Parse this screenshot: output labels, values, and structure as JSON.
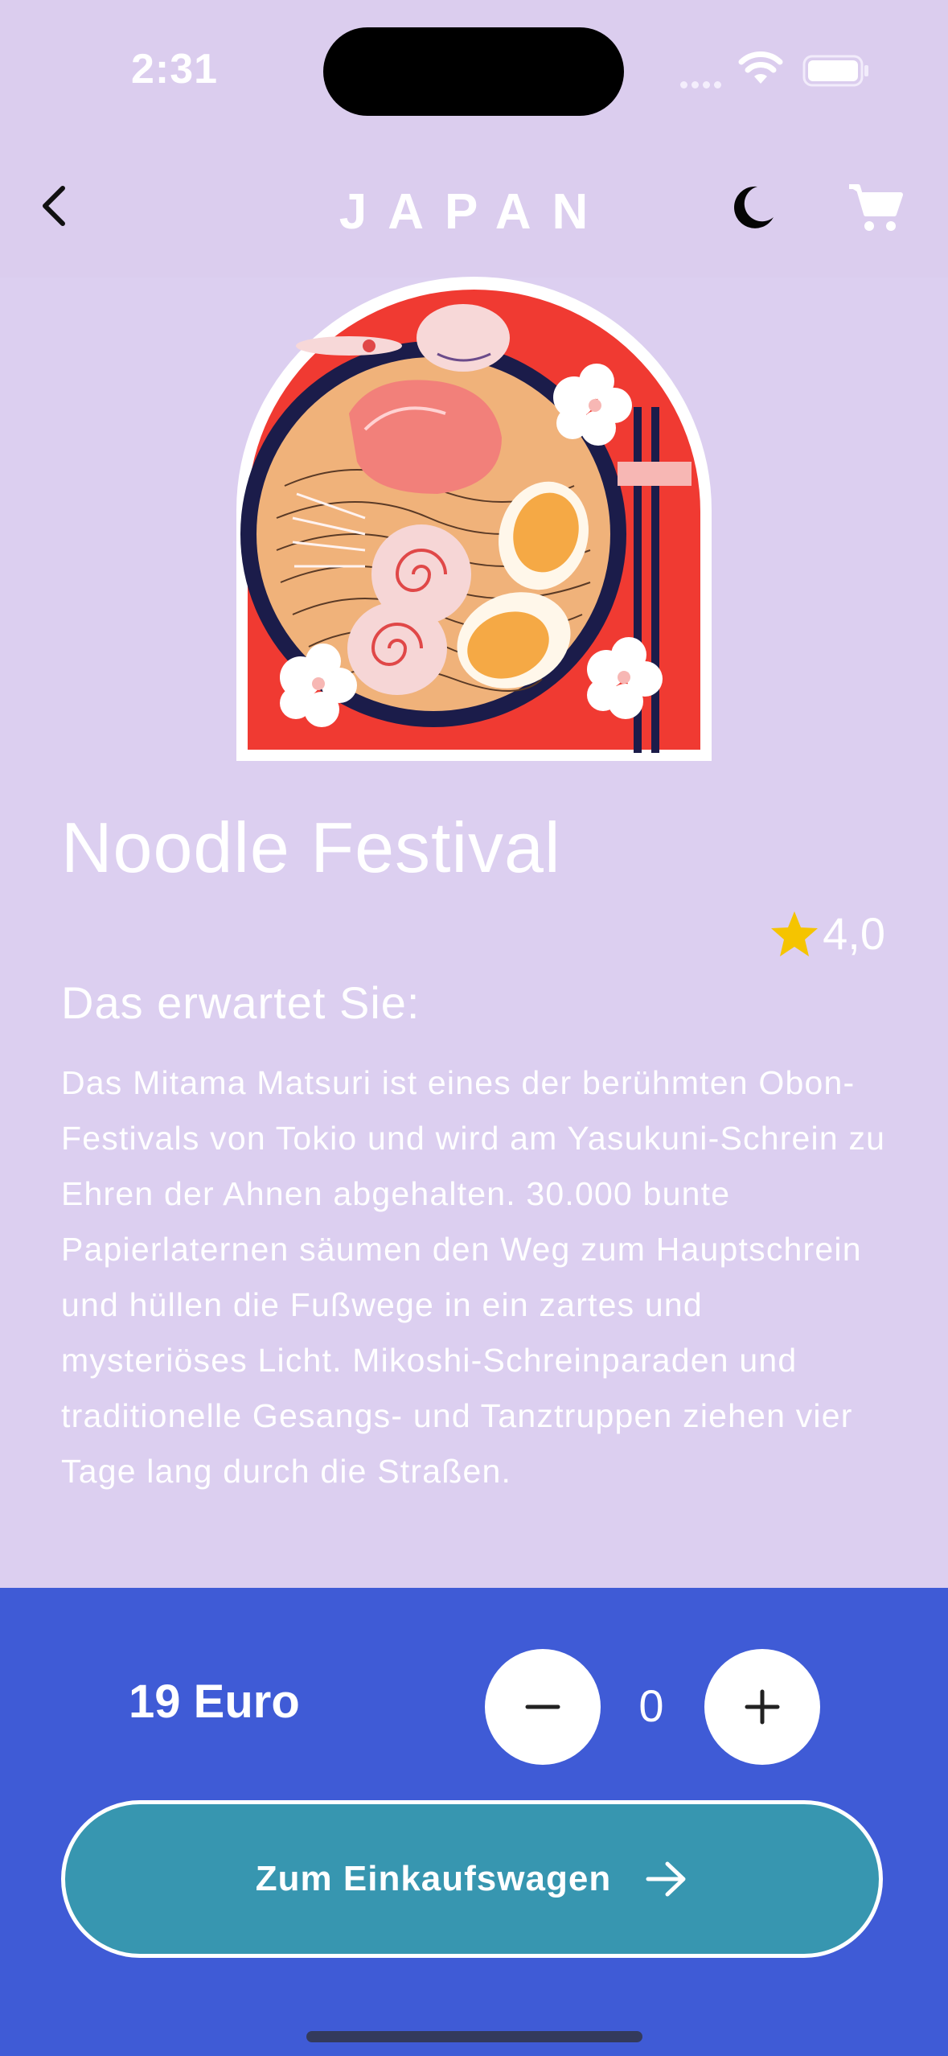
{
  "status_bar": {
    "time": "2:31",
    "icons": [
      "cellular-signal-icon",
      "wifi-icon",
      "battery-icon"
    ]
  },
  "nav": {
    "title": "JAPAN",
    "back_icon": "chevron-left-icon",
    "theme_icon": "moon-icon",
    "cart_icon": "shopping-cart-icon"
  },
  "product": {
    "image": "ramen-bowl-illustration",
    "title": "Noodle Festival",
    "rating": "4,0",
    "rating_icon": "star-icon",
    "section_heading": "Das erwartet Sie:",
    "description": "Das Mitama Matsuri ist eines der berühmten Obon-Festivals von Tokio und wird am Yasukuni-Schrein zu Ehren der Ahnen abgehalten. 30.000 bunte Papierlaternen säumen den Weg zum Hauptschrein und hüllen die Fußwege in ein zartes und mysteriöses Licht. Mikoshi-Schreinparaden und traditionelle Gesangs- und Tanztruppen ziehen vier Tage lang durch die Straßen."
  },
  "purchase": {
    "price": "19 Euro",
    "quantity": "0",
    "decrement_icon": "minus-icon",
    "increment_icon": "plus-icon",
    "cta_label": "Zum Einkaufswagen",
    "cta_icon": "arrow-right-icon"
  },
  "colors": {
    "background": "#dccff0",
    "footer": "#3f5bd6",
    "cta": "#3796b0",
    "star": "#f5c400",
    "illustration_red": "#f03a32"
  }
}
